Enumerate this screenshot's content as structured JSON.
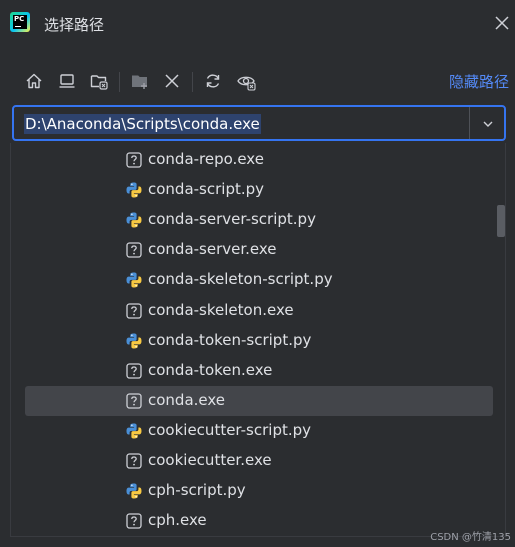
{
  "window": {
    "title": "选择路径",
    "logo_text": "PC"
  },
  "toolbar": {
    "buttons": [
      {
        "icon": "home-icon"
      },
      {
        "icon": "desktop-icon"
      },
      {
        "icon": "project-folder-icon"
      },
      {
        "icon": "new-folder-icon"
      },
      {
        "icon": "delete-icon"
      },
      {
        "icon": "refresh-icon"
      },
      {
        "icon": "show-hidden-icon"
      }
    ],
    "hide_path_label": "隐藏路径"
  },
  "path_field": {
    "value": "D:\\Anaconda\\Scripts\\conda.exe"
  },
  "file_list": {
    "items": [
      {
        "name": "conda-repo.exe",
        "type": "exe"
      },
      {
        "name": "conda-script.py",
        "type": "py"
      },
      {
        "name": "conda-server-script.py",
        "type": "py"
      },
      {
        "name": "conda-server.exe",
        "type": "exe"
      },
      {
        "name": "conda-skeleton-script.py",
        "type": "py"
      },
      {
        "name": "conda-skeleton.exe",
        "type": "exe"
      },
      {
        "name": "conda-token-script.py",
        "type": "py"
      },
      {
        "name": "conda-token.exe",
        "type": "exe"
      },
      {
        "name": "conda.exe",
        "type": "exe",
        "selected": true
      },
      {
        "name": "cookiecutter-script.py",
        "type": "py"
      },
      {
        "name": "cookiecutter.exe",
        "type": "exe"
      },
      {
        "name": "cph-script.py",
        "type": "py"
      },
      {
        "name": "cph.exe",
        "type": "exe"
      }
    ]
  },
  "watermark": "CSDN @竹清135",
  "colors": {
    "background": "#2b2d30",
    "accent": "#3574f0",
    "link": "#548af7",
    "selection": "#43454a"
  }
}
